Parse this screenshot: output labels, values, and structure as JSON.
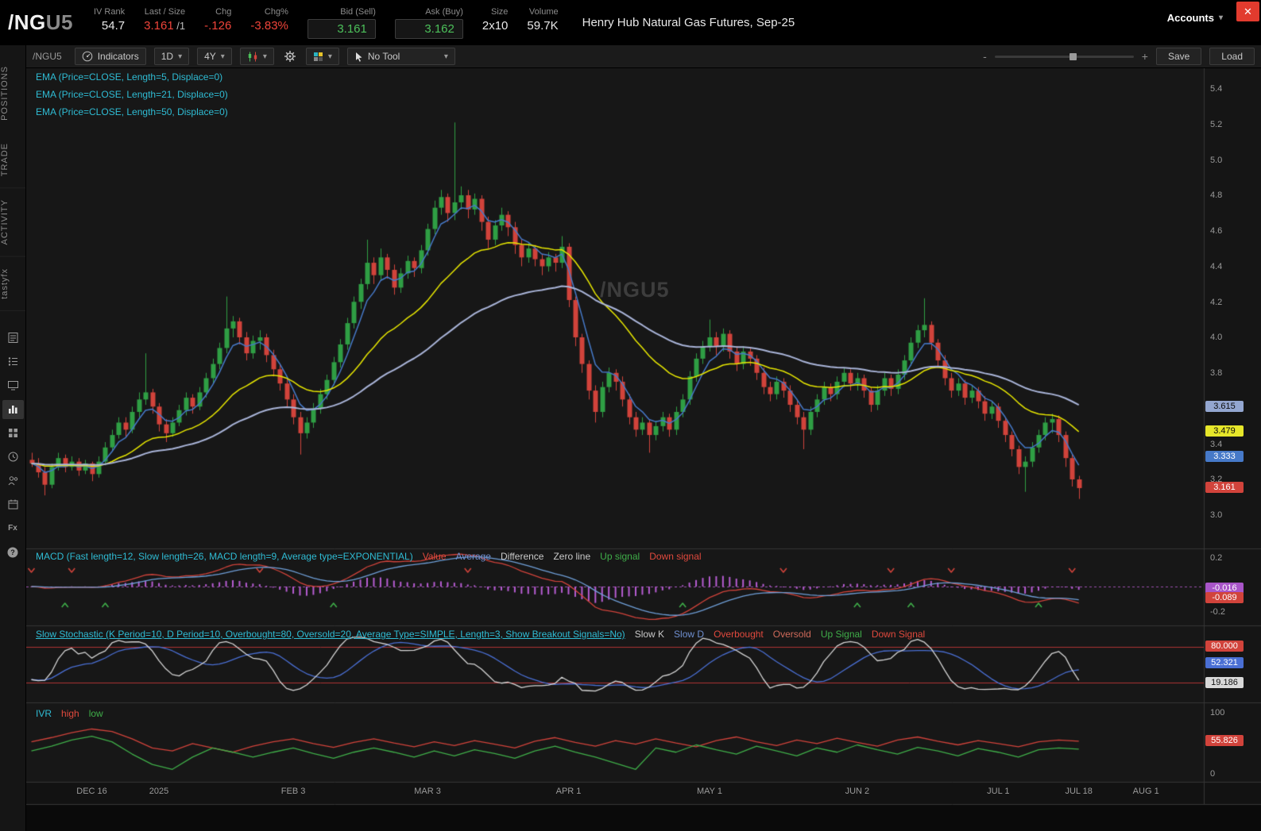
{
  "header": {
    "symbol": "/NG",
    "symbol_suffix": "U5",
    "fields": [
      {
        "label": "IV Rank",
        "value": "54.7"
      },
      {
        "label": "Last / Size",
        "value": "3.161",
        "suffix": " /1"
      },
      {
        "label": "Chg",
        "value": "-.126"
      },
      {
        "label": "Chg%",
        "value": "-3.83%"
      },
      {
        "label": "Bid (Sell)",
        "value": "3.161"
      },
      {
        "label": "Ask (Buy)",
        "value": "3.162"
      },
      {
        "label": "Size",
        "value": "2x10"
      },
      {
        "label": "Volume",
        "value": "59.7K"
      }
    ],
    "description": "Henry Hub Natural Gas Futures, Sep-25",
    "accounts_label": "Accounts",
    "accounts_caret": "▾",
    "close_label": "✕"
  },
  "sidebar": {
    "tabs": [
      "POSITIONS",
      "TRADE",
      "ACTIVITY",
      "tastyfx"
    ],
    "icons": [
      "notes-icon",
      "watchlist-icon",
      "platform-icon",
      "chart-icon",
      "apps-icon",
      "history-icon",
      "contacts-icon",
      "calendar-icon",
      "fx-icon",
      "help-icon"
    ]
  },
  "toolbar": {
    "symbol": "/NGU5",
    "indicators": "Indicators",
    "timeframe": "1D",
    "range": "4Y",
    "tool": "No Tool",
    "caret": "▾",
    "zoom_out": "-",
    "zoom_in": "+",
    "save": "Save",
    "load": "Load"
  },
  "studies": [
    "EMA (Price=CLOSE, Length=5, Displace=0)",
    "EMA (Price=CLOSE, Length=21, Displace=0)",
    "EMA (Price=CLOSE, Length=50, Displace=0)"
  ],
  "watermark": "/NGU5",
  "chart_data": {
    "type": "candlestick",
    "symbol": "/NGU5",
    "price_axis": [
      "5.4",
      "5.2",
      "5.0",
      "4.8",
      "4.6",
      "4.4",
      "4.2",
      "4.0",
      "3.8",
      "3.6",
      "3.4",
      "3.2",
      "3.0"
    ],
    "time_ticks": [
      {
        "label": "DEC 16",
        "i": 9
      },
      {
        "label": "2025",
        "i": 19
      },
      {
        "label": "FEB 3",
        "i": 39
      },
      {
        "label": "MAR 3",
        "i": 59
      },
      {
        "label": "APR 1",
        "i": 80
      },
      {
        "label": "MAY 1",
        "i": 101
      },
      {
        "label": "JUN 2",
        "i": 123
      },
      {
        "label": "JUL 1",
        "i": 144
      },
      {
        "label": "JUL 18",
        "i": 156
      },
      {
        "label": "AUG 1",
        "i": 166
      }
    ],
    "candles": [
      [
        3.32,
        3.36,
        3.28,
        3.3
      ],
      [
        3.3,
        3.33,
        3.22,
        3.25
      ],
      [
        3.25,
        3.28,
        3.12,
        3.18
      ],
      [
        3.18,
        3.3,
        3.16,
        3.28
      ],
      [
        3.28,
        3.36,
        3.26,
        3.33
      ],
      [
        3.33,
        3.35,
        3.25,
        3.28
      ],
      [
        3.28,
        3.34,
        3.26,
        3.31
      ],
      [
        3.31,
        3.33,
        3.23,
        3.26
      ],
      [
        3.26,
        3.32,
        3.24,
        3.3
      ],
      [
        3.3,
        3.31,
        3.2,
        3.24
      ],
      [
        3.24,
        3.34,
        3.22,
        3.31
      ],
      [
        3.31,
        3.42,
        3.29,
        3.39
      ],
      [
        3.39,
        3.49,
        3.37,
        3.46
      ],
      [
        3.46,
        3.56,
        3.44,
        3.53
      ],
      [
        3.53,
        3.56,
        3.45,
        3.49
      ],
      [
        3.49,
        3.62,
        3.47,
        3.59
      ],
      [
        3.59,
        3.7,
        3.56,
        3.66
      ],
      [
        3.66,
        3.92,
        3.63,
        3.7
      ],
      [
        3.7,
        3.72,
        3.58,
        3.62
      ],
      [
        3.62,
        3.64,
        3.48,
        3.52
      ],
      [
        3.52,
        3.55,
        3.42,
        3.47
      ],
      [
        3.47,
        3.56,
        3.45,
        3.53
      ],
      [
        3.53,
        3.63,
        3.51,
        3.6
      ],
      [
        3.6,
        3.7,
        3.57,
        3.67
      ],
      [
        3.67,
        3.69,
        3.58,
        3.62
      ],
      [
        3.62,
        3.73,
        3.6,
        3.7
      ],
      [
        3.7,
        3.81,
        3.67,
        3.78
      ],
      [
        3.78,
        3.89,
        3.75,
        3.86
      ],
      [
        3.86,
        3.98,
        3.83,
        3.95
      ],
      [
        3.95,
        4.24,
        3.92,
        4.06
      ],
      [
        4.06,
        4.13,
        4.01,
        4.1
      ],
      [
        4.1,
        4.12,
        3.97,
        4.01
      ],
      [
        4.01,
        4.04,
        3.88,
        3.92
      ],
      [
        3.92,
        4.02,
        3.89,
        3.99
      ],
      [
        3.99,
        4.05,
        3.94,
        4.01
      ],
      [
        4.01,
        4.03,
        3.87,
        3.91
      ],
      [
        3.91,
        3.94,
        3.79,
        3.83
      ],
      [
        3.83,
        3.86,
        3.71,
        3.75
      ],
      [
        3.75,
        3.78,
        3.62,
        3.66
      ],
      [
        3.66,
        3.69,
        3.52,
        3.56
      ],
      [
        3.56,
        3.59,
        3.35,
        3.47
      ],
      [
        3.47,
        3.56,
        3.44,
        3.53
      ],
      [
        3.53,
        3.64,
        3.5,
        3.61
      ],
      [
        3.61,
        3.72,
        3.58,
        3.69
      ],
      [
        3.69,
        3.8,
        3.66,
        3.77
      ],
      [
        3.77,
        3.9,
        3.74,
        3.87
      ],
      [
        3.87,
        4.0,
        3.84,
        3.97
      ],
      [
        3.97,
        4.12,
        3.94,
        4.09
      ],
      [
        4.09,
        4.24,
        4.06,
        4.21
      ],
      [
        4.21,
        4.34,
        4.17,
        4.31
      ],
      [
        4.31,
        4.56,
        4.28,
        4.43
      ],
      [
        4.43,
        4.46,
        4.31,
        4.36
      ],
      [
        4.36,
        4.51,
        4.33,
        4.46
      ],
      [
        4.46,
        4.48,
        4.34,
        4.39
      ],
      [
        4.39,
        4.42,
        4.25,
        4.29
      ],
      [
        4.29,
        4.4,
        4.26,
        4.37
      ],
      [
        4.37,
        4.47,
        4.34,
        4.44
      ],
      [
        4.44,
        4.46,
        4.35,
        4.4
      ],
      [
        4.4,
        4.53,
        4.37,
        4.5
      ],
      [
        4.5,
        4.65,
        4.47,
        4.62
      ],
      [
        4.62,
        4.78,
        4.59,
        4.74
      ],
      [
        4.74,
        4.84,
        4.7,
        4.8
      ],
      [
        4.8,
        4.82,
        4.66,
        4.71
      ],
      [
        4.71,
        5.22,
        4.67,
        4.77
      ],
      [
        4.77,
        4.86,
        4.73,
        4.81
      ],
      [
        4.81,
        4.84,
        4.68,
        4.73
      ],
      [
        4.73,
        4.82,
        4.7,
        4.79
      ],
      [
        4.79,
        4.81,
        4.61,
        4.66
      ],
      [
        4.66,
        4.69,
        4.51,
        4.56
      ],
      [
        4.56,
        4.67,
        4.53,
        4.64
      ],
      [
        4.64,
        4.74,
        4.61,
        4.7
      ],
      [
        4.7,
        4.72,
        4.58,
        4.63
      ],
      [
        4.63,
        4.66,
        4.48,
        4.53
      ],
      [
        4.53,
        4.56,
        4.41,
        4.46
      ],
      [
        4.46,
        4.54,
        4.43,
        4.51
      ],
      [
        4.51,
        4.53,
        4.41,
        4.45
      ],
      [
        4.45,
        4.48,
        4.36,
        4.41
      ],
      [
        4.41,
        4.49,
        4.38,
        4.46
      ],
      [
        4.46,
        4.48,
        4.38,
        4.43
      ],
      [
        4.43,
        4.58,
        4.4,
        4.52
      ],
      [
        4.52,
        4.54,
        4.18,
        4.22
      ],
      [
        4.22,
        4.24,
        3.96,
        4.01
      ],
      [
        4.01,
        4.03,
        3.81,
        3.86
      ],
      [
        3.86,
        3.88,
        3.66,
        3.71
      ],
      [
        3.71,
        3.74,
        3.53,
        3.59
      ],
      [
        3.59,
        3.76,
        3.56,
        3.73
      ],
      [
        3.73,
        3.84,
        3.7,
        3.81
      ],
      [
        3.81,
        3.83,
        3.71,
        3.76
      ],
      [
        3.76,
        3.79,
        3.62,
        3.66
      ],
      [
        3.66,
        3.69,
        3.52,
        3.56
      ],
      [
        3.56,
        3.59,
        3.45,
        3.49
      ],
      [
        3.49,
        3.56,
        3.46,
        3.53
      ],
      [
        3.53,
        3.55,
        3.36,
        3.46
      ],
      [
        3.46,
        3.54,
        3.43,
        3.51
      ],
      [
        3.51,
        3.59,
        3.48,
        3.56
      ],
      [
        3.56,
        3.58,
        3.45,
        3.49
      ],
      [
        3.49,
        3.62,
        3.46,
        3.59
      ],
      [
        3.59,
        3.69,
        3.56,
        3.66
      ],
      [
        3.66,
        3.82,
        3.63,
        3.79
      ],
      [
        3.79,
        3.92,
        3.76,
        3.89
      ],
      [
        3.89,
        3.99,
        3.86,
        3.96
      ],
      [
        3.96,
        4.11,
        3.93,
        4.01
      ],
      [
        4.01,
        4.04,
        3.91,
        3.96
      ],
      [
        3.96,
        4.06,
        3.93,
        4.03
      ],
      [
        4.03,
        4.05,
        3.89,
        3.93
      ],
      [
        3.93,
        3.96,
        3.82,
        3.86
      ],
      [
        3.86,
        3.96,
        3.83,
        3.93
      ],
      [
        3.93,
        3.95,
        3.85,
        3.89
      ],
      [
        3.89,
        3.91,
        3.77,
        3.81
      ],
      [
        3.81,
        3.84,
        3.69,
        3.73
      ],
      [
        3.73,
        3.76,
        3.65,
        3.69
      ],
      [
        3.69,
        3.79,
        3.66,
        3.76
      ],
      [
        3.76,
        3.78,
        3.67,
        3.71
      ],
      [
        3.71,
        3.74,
        3.59,
        3.63
      ],
      [
        3.63,
        3.66,
        3.52,
        3.56
      ],
      [
        3.56,
        3.59,
        3.38,
        3.49
      ],
      [
        3.49,
        3.62,
        3.46,
        3.59
      ],
      [
        3.59,
        3.69,
        3.56,
        3.66
      ],
      [
        3.66,
        3.76,
        3.63,
        3.73
      ],
      [
        3.73,
        3.75,
        3.65,
        3.69
      ],
      [
        3.69,
        3.79,
        3.66,
        3.76
      ],
      [
        3.76,
        3.84,
        3.73,
        3.81
      ],
      [
        3.81,
        3.83,
        3.71,
        3.75
      ],
      [
        3.75,
        3.81,
        3.71,
        3.78
      ],
      [
        3.78,
        3.8,
        3.67,
        3.71
      ],
      [
        3.71,
        3.73,
        3.59,
        3.63
      ],
      [
        3.63,
        3.74,
        3.6,
        3.71
      ],
      [
        3.71,
        3.81,
        3.68,
        3.78
      ],
      [
        3.78,
        3.8,
        3.68,
        3.72
      ],
      [
        3.72,
        3.83,
        3.69,
        3.8
      ],
      [
        3.8,
        3.91,
        3.77,
        3.88
      ],
      [
        3.88,
        4.01,
        3.85,
        3.98
      ],
      [
        3.98,
        4.08,
        3.95,
        4.05
      ],
      [
        4.05,
        4.23,
        4.01,
        4.08
      ],
      [
        4.08,
        4.1,
        3.94,
        3.98
      ],
      [
        3.98,
        4.0,
        3.84,
        3.88
      ],
      [
        3.88,
        3.91,
        3.74,
        3.78
      ],
      [
        3.78,
        3.81,
        3.67,
        3.71
      ],
      [
        3.71,
        3.78,
        3.68,
        3.75
      ],
      [
        3.75,
        3.77,
        3.63,
        3.67
      ],
      [
        3.67,
        3.74,
        3.64,
        3.71
      ],
      [
        3.71,
        3.73,
        3.61,
        3.65
      ],
      [
        3.65,
        3.68,
        3.54,
        3.58
      ],
      [
        3.58,
        3.65,
        3.55,
        3.62
      ],
      [
        3.62,
        3.64,
        3.5,
        3.54
      ],
      [
        3.54,
        3.56,
        3.42,
        3.46
      ],
      [
        3.46,
        3.48,
        3.34,
        3.38
      ],
      [
        3.38,
        3.4,
        3.24,
        3.28
      ],
      [
        3.28,
        3.34,
        3.14,
        3.31
      ],
      [
        3.31,
        3.42,
        3.28,
        3.39
      ],
      [
        3.39,
        3.49,
        3.36,
        3.46
      ],
      [
        3.46,
        3.56,
        3.43,
        3.53
      ],
      [
        3.53,
        3.58,
        3.47,
        3.55
      ],
      [
        3.55,
        3.57,
        3.42,
        3.46
      ],
      [
        3.46,
        3.48,
        3.28,
        3.33
      ],
      [
        3.33,
        3.35,
        3.17,
        3.21
      ],
      [
        3.21,
        3.23,
        3.1,
        3.161
      ]
    ],
    "emas": [
      {
        "length": 5,
        "color": "#4679c8"
      },
      {
        "length": 21,
        "color": "#e6e600"
      },
      {
        "length": 50,
        "color": "#a9b4d8"
      }
    ],
    "price_badges": [
      {
        "text": "3.615",
        "bg": "#93a6d0",
        "fg": "#0b0b0b"
      },
      {
        "text": "3.479",
        "bg": "#e6e62a",
        "fg": "#0b0b0b"
      },
      {
        "text": "3.333",
        "bg": "#4679c8",
        "fg": "#ffffff"
      },
      {
        "text": "3.161",
        "bg": "#d1433b",
        "fg": "#ffffff"
      }
    ],
    "macd": {
      "label": "MACD (Fast length=12, Slow length=26, MACD length=9, Average type=EXPONENTIAL)",
      "legend": [
        "Value",
        "Average",
        "Difference",
        "Zero line",
        "Up signal",
        "Down signal"
      ],
      "fast": 12,
      "slow": 26,
      "signal": 9,
      "axis": [
        "0.2",
        "-0.2"
      ],
      "up_signals": [
        5,
        11,
        45,
        97,
        123,
        131,
        150
      ],
      "down_signals": [
        0,
        6,
        34,
        65,
        112,
        128,
        137,
        155
      ],
      "badges": [
        {
          "text": "-0.016",
          "bg": "#a855c8",
          "fg": "#ffffff"
        },
        {
          "text": "-0.089",
          "bg": "#d1433b",
          "fg": "#ffffff"
        }
      ]
    },
    "stochastic": {
      "label": "Slow Stochastic (K Period=10, D Period=10, Overbought=80, Oversold=20, Average Type=SIMPLE, Length=3, Show Breakout Signals=No)",
      "legend": [
        "Slow K",
        "Slow D",
        "Overbought",
        "Oversold",
        "Up Signal",
        "Down Signal"
      ],
      "k_period": 10,
      "d_period": 10,
      "smoothing": 3,
      "overbought": 80,
      "oversold": 20,
      "badges": [
        {
          "text": "80.000",
          "bg": "#d1433b",
          "fg": "#ffffff"
        },
        {
          "text": "52.321",
          "bg": "#4a6fd4",
          "fg": "#ffffff"
        },
        {
          "text": "19.186",
          "bg": "#d8d8d8",
          "fg": "#111111"
        }
      ]
    },
    "ivr": {
      "label": "IVR",
      "legend_high": "high",
      "legend_low": "low",
      "axis": [
        "100",
        "0"
      ],
      "badge": {
        "text": "55.826",
        "bg": "#d1433b",
        "fg": "#ffffff"
      },
      "sample_step": 3,
      "high": [
        55,
        62,
        70,
        76,
        72,
        60,
        45,
        40,
        52,
        45,
        38,
        48,
        55,
        60,
        52,
        46,
        54,
        60,
        53,
        47,
        55,
        49,
        57,
        51,
        45,
        56,
        62,
        54,
        48,
        57,
        51,
        60,
        53,
        47,
        57,
        63,
        55,
        49,
        58,
        52,
        61,
        54,
        48,
        58,
        63,
        56,
        50,
        57,
        52,
        47,
        55,
        58,
        56
      ],
      "low": [
        40,
        48,
        58,
        64,
        55,
        35,
        18,
        10,
        30,
        45,
        38,
        30,
        38,
        45,
        36,
        28,
        38,
        45,
        38,
        30,
        40,
        32,
        42,
        36,
        28,
        40,
        48,
        38,
        30,
        20,
        10,
        45,
        38,
        50,
        42,
        35,
        48,
        40,
        32,
        45,
        38,
        50,
        42,
        35,
        46,
        40,
        32,
        44,
        38,
        30,
        42,
        45,
        43
      ]
    }
  }
}
